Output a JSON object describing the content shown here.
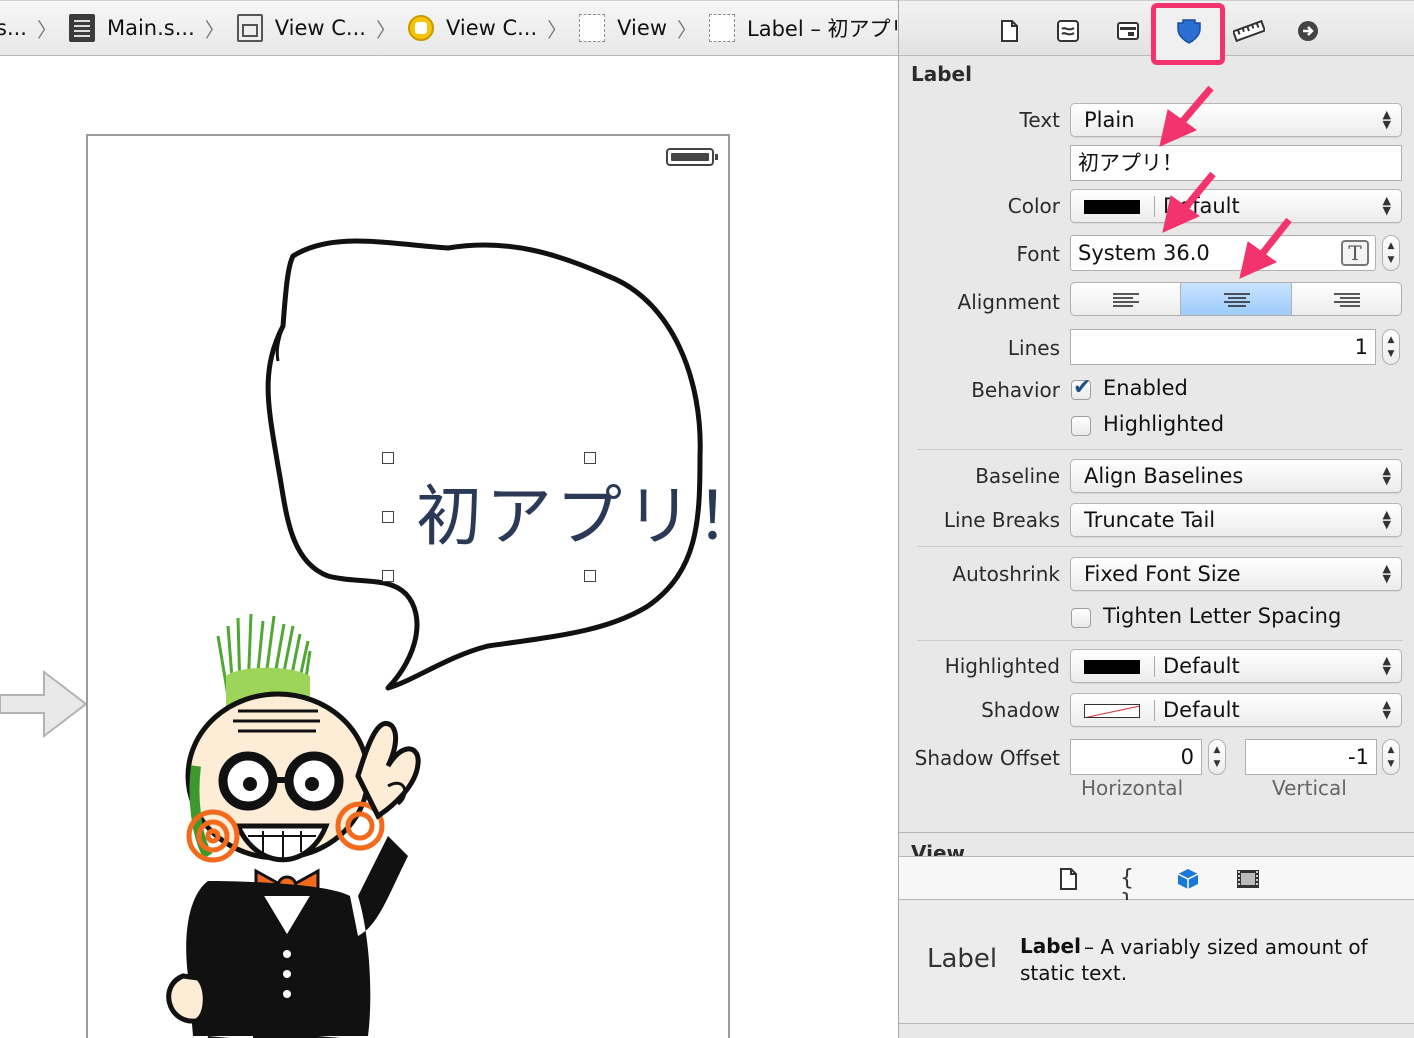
{
  "breadcrumb": [
    {
      "label": "s...",
      "icon": "none"
    },
    {
      "label": "Main.s...",
      "icon": "storyboard-icon"
    },
    {
      "label": "View C...",
      "icon": "scene-icon"
    },
    {
      "label": "View C...",
      "icon": "view-controller-icon"
    },
    {
      "label": "View",
      "icon": "view-icon"
    },
    {
      "label": "Label – 初アプリ！",
      "icon": "label-icon"
    }
  ],
  "canvas": {
    "label_text": "初アプリ！"
  },
  "inspector": {
    "section_title": "Label",
    "text_label": "Text",
    "text_mode": "Plain",
    "text_value": "初アプリ！",
    "color_label": "Color",
    "color_value": "Default",
    "font_label": "Font",
    "font_value": "System 36.0",
    "alignment_label": "Alignment",
    "alignment_selected": "center",
    "lines_label": "Lines",
    "lines_value": "1",
    "behavior_label": "Behavior",
    "enabled_label": "Enabled",
    "enabled_checked": true,
    "highlighted_check_label": "Highlighted",
    "highlighted_checked": false,
    "baseline_label": "Baseline",
    "baseline_value": "Align Baselines",
    "linebreaks_label": "Line Breaks",
    "linebreaks_value": "Truncate Tail",
    "autoshrink_label": "Autoshrink",
    "autoshrink_value": "Fixed Font Size",
    "tighten_label": "Tighten Letter Spacing",
    "tighten_checked": false,
    "highlighted_label": "Highlighted",
    "highlighted_value": "Default",
    "shadow_label": "Shadow",
    "shadow_value": "Default",
    "shadow_offset_label": "Shadow Offset",
    "shadow_h_value": "0",
    "shadow_v_value": "-1",
    "horizontal_label": "Horizontal",
    "vertical_label": "Vertical",
    "view_section_title": "View"
  },
  "library": {
    "thumb_text": "Label",
    "name": "Label",
    "description": "– A variably sized amount of static text."
  },
  "colors": {
    "highlight_frame": "#f2336d",
    "selected_segment": "#9ccbfb",
    "label_text": "#2a3a56"
  }
}
